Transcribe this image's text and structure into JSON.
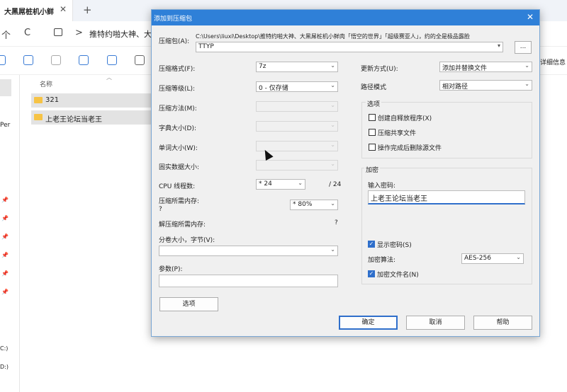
{
  "explorer": {
    "tab_title": "大黑屌桩机小鲜",
    "tab_close": "✕",
    "tab_plus": "+",
    "nav_up": "个",
    "nav_refresh": "C",
    "nav_chevron": ">",
    "address": "推特约啪大神、大",
    "toolbar_details": "详细信息",
    "column_name": "名称",
    "items": [
      {
        "name": "321"
      },
      {
        "name": "上老王论坛当老王"
      }
    ],
    "left_partial_text": "Per",
    "drive_labels": [
      "C:)",
      "D:)"
    ]
  },
  "dialog": {
    "title": "添加到压缩包",
    "close": "✕",
    "archive_label": "压缩包(A):",
    "archive_path": "C:\\Users\\liuxi\\Desktop\\推特约啪大神、大黑屌桩机小鲜肉「悟空的世界」「超级赛亚人」，约的全是极品露脸",
    "archive_name": "TTYP",
    "browse_label": "...",
    "format_label": "压缩格式(F):",
    "format_value": "7z",
    "level_label": "压缩等级(L):",
    "level_value": "0 - 仅存储",
    "method_label": "压缩方法(M):",
    "dict_label": "字典大小(D):",
    "word_label": "单词大小(W):",
    "solid_label": "固实数据大小:",
    "cpu_label": "CPU 线程数:",
    "cpu_value": "* 24",
    "cpu_total": "/ 24",
    "mem_compress_label": "压缩所需内存:",
    "mem_compress_value": "?",
    "mem_percent": "* 80%",
    "mem_decompress_label": "解压缩所需内存:",
    "mem_decompress_value": "?",
    "split_label": "分卷大小，字节(V):",
    "params_label": "参数(P):",
    "options_button": "选项",
    "update_label": "更新方式(U):",
    "update_value": "添加并替换文件",
    "path_mode_label": "路径模式",
    "path_mode_value": "相对路径",
    "options_group_title": "选项",
    "opt_sfx": "创建自释放程序(X)",
    "opt_shared": "压缩共享文件",
    "opt_delete": "操作完成后删除源文件",
    "encrypt_group_title": "加密",
    "password_label": "输入密码:",
    "password_value": "上老王论坛当老王",
    "show_password": "显示密码(S)",
    "encrypt_method_label": "加密算法:",
    "encrypt_method_value": "AES-256",
    "encrypt_names": "加密文件名(N)",
    "ok_button": "确定",
    "cancel_button": "取消",
    "help_button": "帮助"
  },
  "colors": {
    "title_bar": "#2f80d8",
    "dialog_bg": "#f0f0f0",
    "accent": "#2f6fcb",
    "folder": "#f6c345"
  }
}
